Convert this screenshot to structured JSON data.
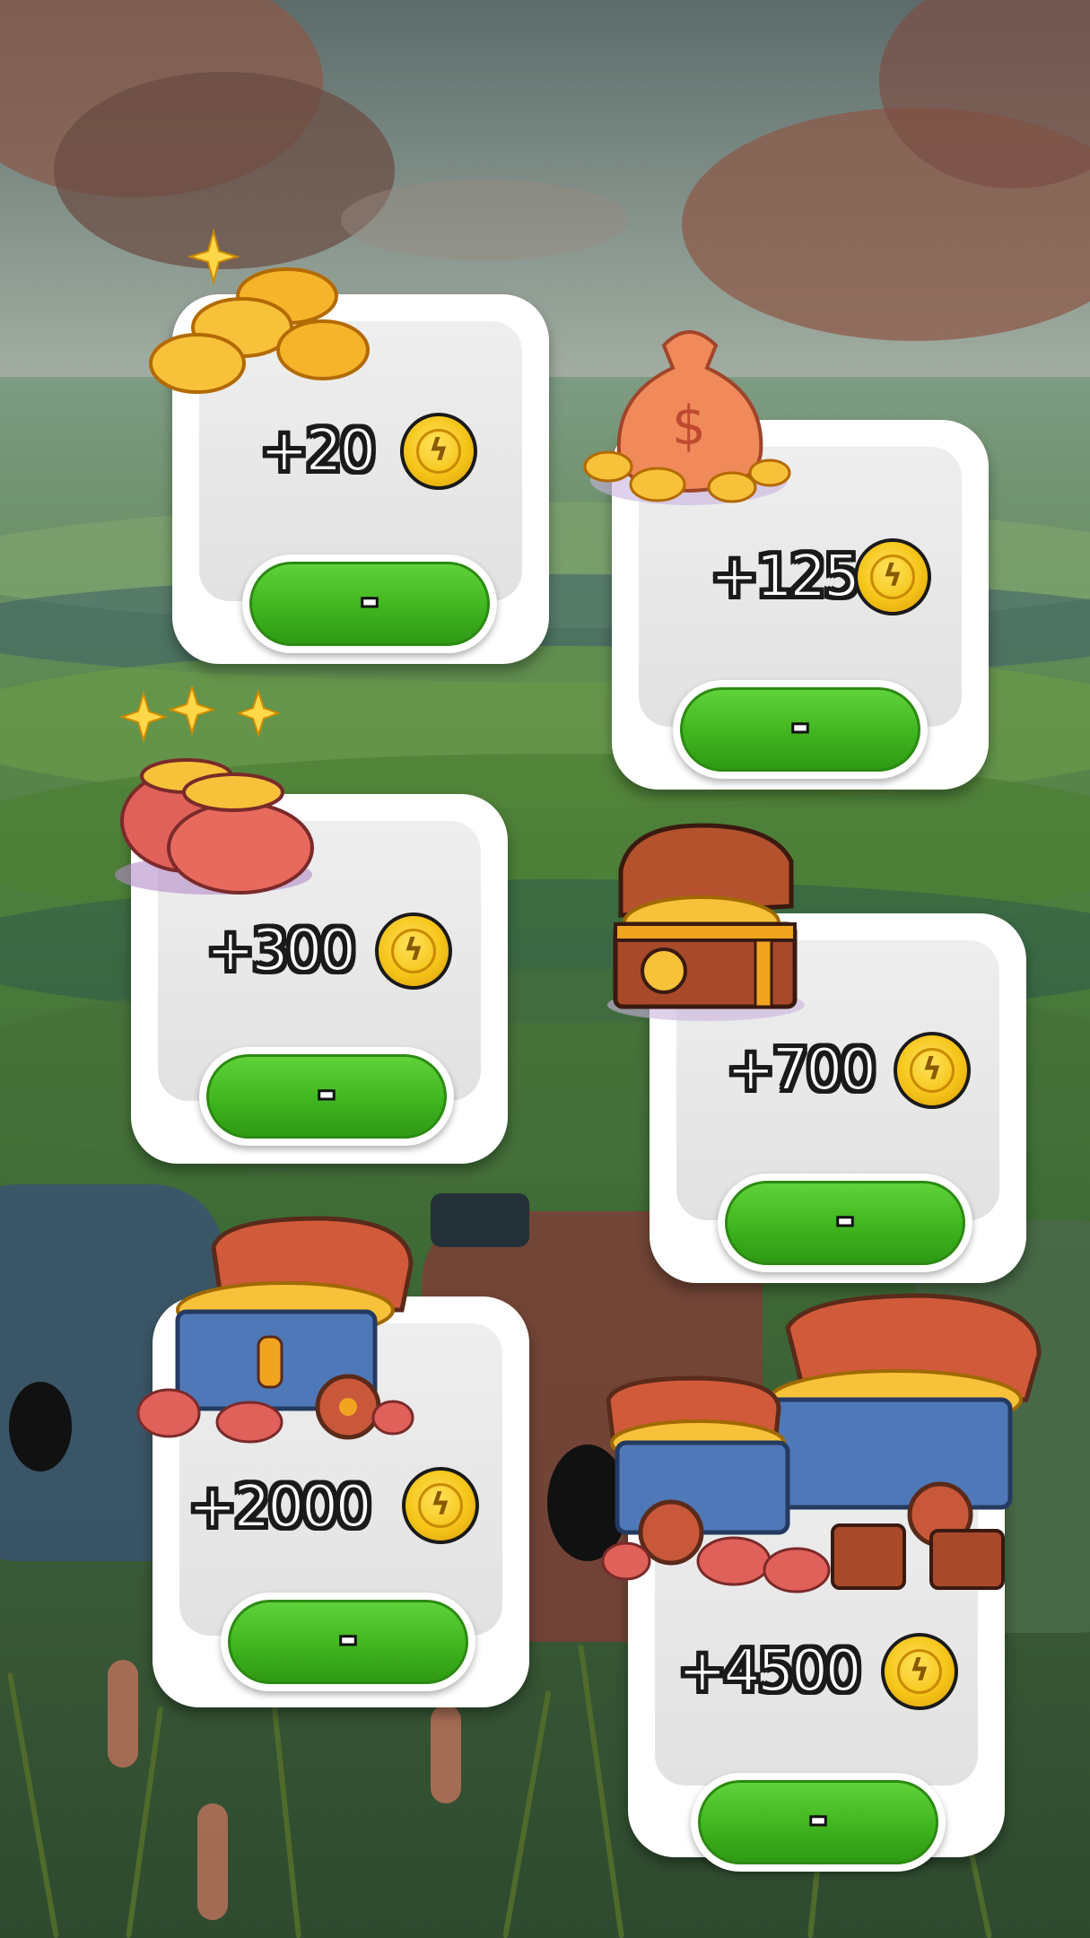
{
  "offers": [
    {
      "amount": "+20",
      "button_label": "-",
      "icon": "coin-pile-icon"
    },
    {
      "amount": "+125",
      "button_label": "-",
      "icon": "money-bag-icon"
    },
    {
      "amount": "+300",
      "button_label": "-",
      "icon": "coin-pouches-icon"
    },
    {
      "amount": "+700",
      "button_label": "-",
      "icon": "treasure-chest-icon"
    },
    {
      "amount": "+2000",
      "button_label": "-",
      "icon": "treasure-cart-icon"
    },
    {
      "amount": "+4500",
      "button_label": "-",
      "icon": "treasure-hoard-icon"
    }
  ],
  "currency_icon": "gold-coin-icon",
  "colors": {
    "button_green": "#3fb51f",
    "card": "#ffffff",
    "coin_gold": "#f5c418"
  }
}
